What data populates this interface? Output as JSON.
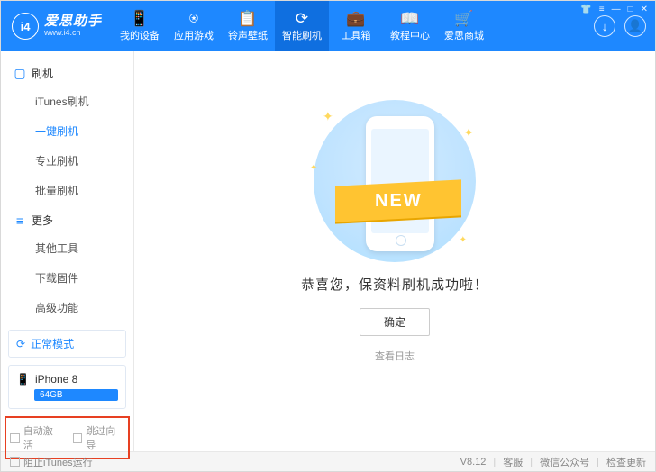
{
  "header": {
    "brand": "爱思助手",
    "url": "www.i4.cn",
    "tabs": [
      {
        "icon": "📱",
        "label": "我的设备"
      },
      {
        "icon": "⍟",
        "label": "应用游戏"
      },
      {
        "icon": "📋",
        "label": "铃声壁纸"
      },
      {
        "icon": "⟳",
        "label": "智能刷机"
      },
      {
        "icon": "💼",
        "label": "工具箱"
      },
      {
        "icon": "📖",
        "label": "教程中心"
      },
      {
        "icon": "🛒",
        "label": "爱思商城"
      }
    ]
  },
  "sidebar": {
    "section1": {
      "title": "刷机",
      "items": [
        "iTunes刷机",
        "一键刷机",
        "专业刷机",
        "批量刷机"
      ]
    },
    "section2": {
      "title": "更多",
      "items": [
        "其他工具",
        "下载固件",
        "高级功能"
      ]
    },
    "mode": "正常模式",
    "device": {
      "name": "iPhone 8",
      "storage": "64GB"
    },
    "checks": {
      "auto": "自动激活",
      "skip": "跳过向导"
    }
  },
  "main": {
    "ribbon": "NEW",
    "message": "恭喜您，保资料刷机成功啦！",
    "confirm": "确定",
    "log": "查看日志"
  },
  "footer": {
    "block_itunes": "阻止iTunes运行",
    "version": "V8.12",
    "links": [
      "客服",
      "微信公众号",
      "检查更新"
    ]
  }
}
